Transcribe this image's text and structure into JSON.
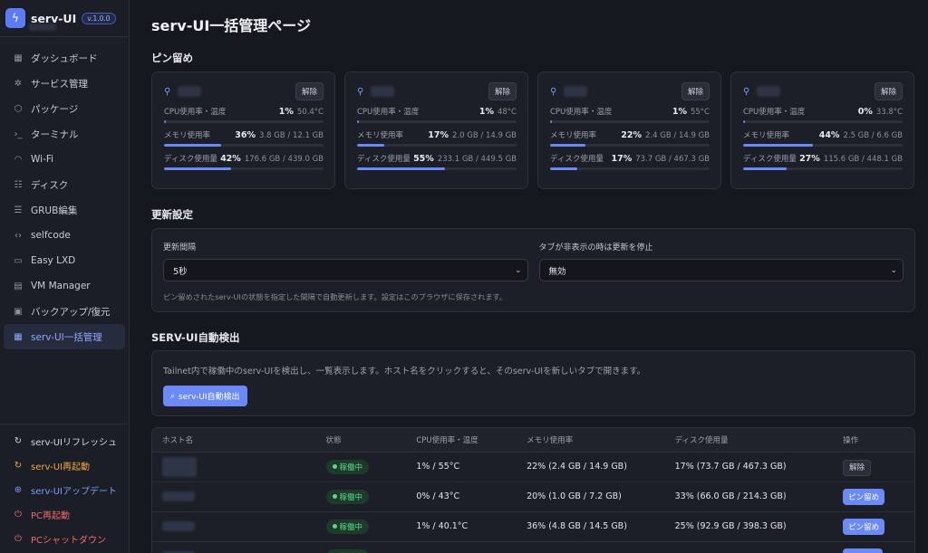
{
  "app": {
    "name": "serv-UI",
    "version": "v.1.0.0",
    "logo_icon": "bolt-icon"
  },
  "nav": [
    {
      "label": "ダッシュボード",
      "icon": "grid-icon",
      "glyph": "▦"
    },
    {
      "label": "サービス管理",
      "icon": "gear-icon",
      "glyph": "✲"
    },
    {
      "label": "パッケージ",
      "icon": "box-icon",
      "glyph": "⬡"
    },
    {
      "label": "ターミナル",
      "icon": "terminal-icon",
      "glyph": "›_"
    },
    {
      "label": "Wi-Fi",
      "icon": "wifi-icon",
      "glyph": "◠"
    },
    {
      "label": "ディスク",
      "icon": "database-icon",
      "glyph": "☷"
    },
    {
      "label": "GRUB編集",
      "icon": "list-icon",
      "glyph": "☰"
    },
    {
      "label": "selfcode",
      "icon": "code-icon",
      "glyph": "‹›"
    },
    {
      "label": "Easy LXD",
      "icon": "monitor-icon",
      "glyph": "▭"
    },
    {
      "label": "VM Manager",
      "icon": "file-icon",
      "glyph": "▤"
    },
    {
      "label": "バックアップ/復元",
      "icon": "archive-icon",
      "glyph": "▣"
    },
    {
      "label": "serv-UI一括管理",
      "icon": "grid-icon",
      "glyph": "▦"
    }
  ],
  "nav_active_index": 11,
  "bottom_actions": [
    {
      "label": "serv-UIリフレッシュ",
      "icon": "refresh-icon",
      "glyph": "↻",
      "color": "#d4d7de"
    },
    {
      "label": "serv-UI再起動",
      "icon": "restart-icon",
      "glyph": "↻",
      "color": "#f0a742"
    },
    {
      "label": "serv-UIアップデート",
      "icon": "update-icon",
      "glyph": "⊕",
      "color": "#7a9bff"
    },
    {
      "label": "PC再起動",
      "icon": "power-icon",
      "glyph": "⏻",
      "color": "#f06a6a"
    },
    {
      "label": "PCシャットダウン",
      "icon": "power-icon",
      "glyph": "⏻",
      "color": "#f06a6a"
    }
  ],
  "page": {
    "title": "serv-UI一括管理ページ"
  },
  "pinned": {
    "title": "ピン留め",
    "unpin_label": "解除",
    "cpu_label": "CPU使用率・温度",
    "mem_label": "メモリ使用率",
    "disk_label": "ディスク使用量",
    "cards": [
      {
        "cpu_pct": "1%",
        "cpu_detail": "50.4°C",
        "cpu_fill": 1,
        "mem_pct": "36%",
        "mem_detail": "3.8 GB / 12.1 GB",
        "mem_fill": 36,
        "disk_pct": "42%",
        "disk_detail": "176.6 GB / 439.0 GB",
        "disk_fill": 42
      },
      {
        "cpu_pct": "1%",
        "cpu_detail": "48°C",
        "cpu_fill": 1,
        "mem_pct": "17%",
        "mem_detail": "2.0 GB / 14.9 GB",
        "mem_fill": 17,
        "disk_pct": "55%",
        "disk_detail": "233.1 GB / 449.5 GB",
        "disk_fill": 55
      },
      {
        "cpu_pct": "1%",
        "cpu_detail": "55°C",
        "cpu_fill": 1,
        "mem_pct": "22%",
        "mem_detail": "2.4 GB / 14.9 GB",
        "mem_fill": 22,
        "disk_pct": "17%",
        "disk_detail": "73.7 GB / 467.3 GB",
        "disk_fill": 17
      },
      {
        "cpu_pct": "0%",
        "cpu_detail": "33.8°C",
        "cpu_fill": 0,
        "mem_pct": "44%",
        "mem_detail": "2.5 GB / 6.6 GB",
        "mem_fill": 44,
        "disk_pct": "27%",
        "disk_detail": "115.6 GB / 448.1 GB",
        "disk_fill": 27
      }
    ]
  },
  "update": {
    "title": "更新設定",
    "interval_label": "更新間隔",
    "interval_value": "5秒",
    "pause_label": "タブが非表示の時は更新を停止",
    "pause_value": "無効",
    "hint": "ピン留めされたserv-UIの状態を指定した間隔で自動更新します。設定はこのブラウザに保存されます。"
  },
  "detect": {
    "title": "SERV-UI自動検出",
    "description": "Tailnet内で稼働中のserv-UIを検出し、一覧表示します。ホスト名をクリックすると、そのserv-UIを新しいタブで開きます。",
    "button_label": "serv-UI自動検出"
  },
  "table": {
    "headers": [
      "ホスト名",
      "状態",
      "CPU使用率・温度",
      "メモリ使用率",
      "ディスク使用量",
      "操作"
    ],
    "rows": [
      {
        "status": "稼働中",
        "cpu": "1% / 55°C",
        "mem": "22% (2.4 GB / 14.9 GB)",
        "disk": "17% (73.7 GB / 467.3 GB)",
        "action": "解除",
        "action_type": "unpin"
      },
      {
        "status": "稼働中",
        "cpu": "0% / 43°C",
        "mem": "20% (1.0 GB / 7.2 GB)",
        "disk": "33% (66.0 GB / 214.3 GB)",
        "action": "ピン留め",
        "action_type": "pin"
      },
      {
        "status": "稼働中",
        "cpu": "1% / 40.1°C",
        "mem": "36% (4.8 GB / 14.5 GB)",
        "disk": "25% (92.9 GB / 398.3 GB)",
        "action": "ピン留め",
        "action_type": "pin"
      },
      {
        "status": "稼働中",
        "cpu": "",
        "mem": "",
        "disk": "",
        "action": "",
        "action_type": "pin"
      }
    ]
  },
  "colors": {
    "accent": "#6b8af5",
    "success": "#5fd58a",
    "warning": "#f0a742",
    "danger": "#f06a6a"
  }
}
